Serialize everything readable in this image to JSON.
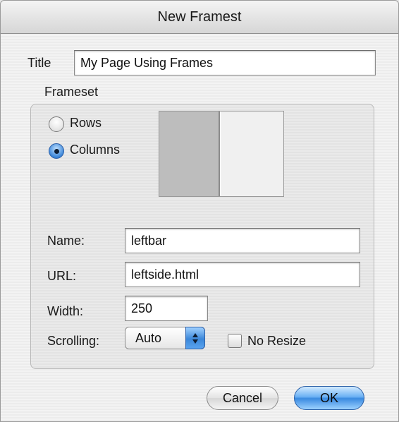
{
  "window": {
    "title": "New Framest"
  },
  "form": {
    "title_label": "Title",
    "title_value": "My Page Using Frames",
    "frameset_label": "Frameset",
    "rows_label": "Rows",
    "columns_label": "Columns",
    "selected_layout": "Columns",
    "name_label": "Name:",
    "name_value": "leftbar",
    "url_label": "URL:",
    "url_value": "leftside.html",
    "width_label": "Width:",
    "width_value": "250",
    "scrolling_label": "Scrolling:",
    "scrolling_value": "Auto",
    "no_resize_label": "No Resize",
    "no_resize_checked": false
  },
  "buttons": {
    "cancel": "Cancel",
    "ok": "OK"
  },
  "colors": {
    "accent": "#3a8ae0",
    "preview_selected": "#bdbdbd"
  }
}
